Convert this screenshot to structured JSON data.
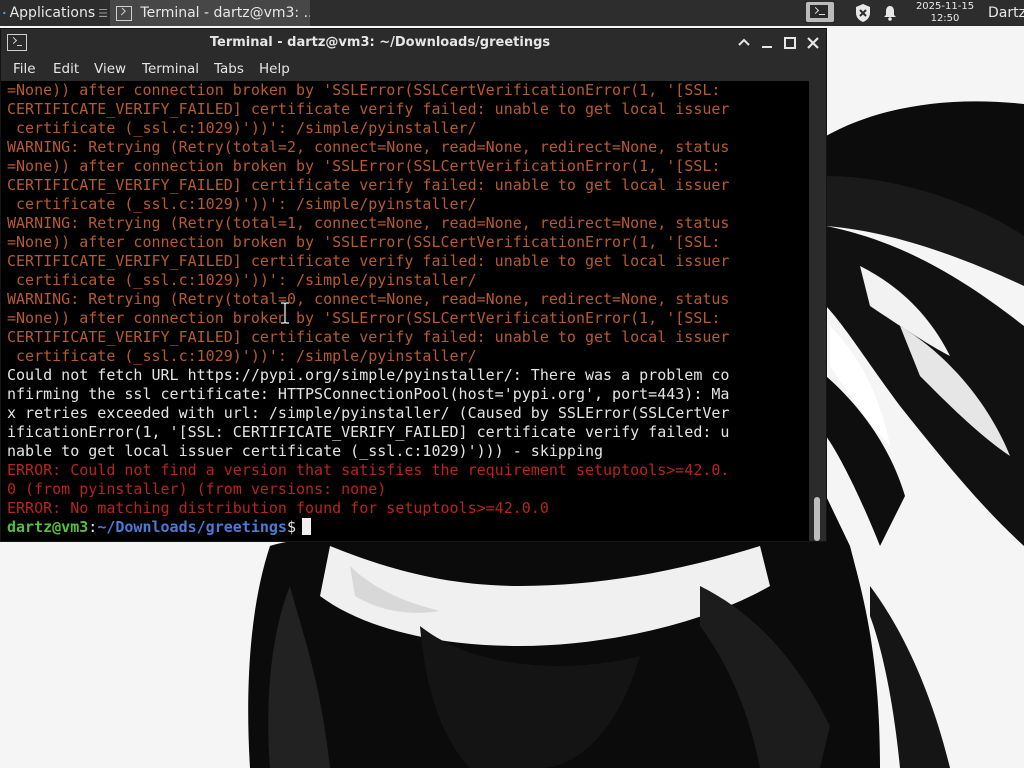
{
  "panel": {
    "apps_label": "Applications",
    "apps_sep": "☰",
    "task_label": "Terminal - dartz@vm3: ...",
    "clock_date": "2025-11-15",
    "clock_time": "12:50",
    "user": "Dartz"
  },
  "window": {
    "title": "Terminal - dartz@vm3: ~/Downloads/greetings",
    "menu": [
      "File",
      "Edit",
      "View",
      "Terminal",
      "Tabs",
      "Help"
    ]
  },
  "terminal": {
    "lines": [
      {
        "t": "warn",
        "text": "=None)) after connection broken by 'SSLError(SSLCertVerificationError(1, '[SSL:"
      },
      {
        "t": "warn",
        "text": "CERTIFICATE_VERIFY_FAILED] certificate verify failed: unable to get local issuer"
      },
      {
        "t": "warn",
        "text": " certificate (_ssl.c:1029)'))': /simple/pyinstaller/"
      },
      {
        "t": "warn",
        "text": "WARNING: Retrying (Retry(total=2, connect=None, read=None, redirect=None, status"
      },
      {
        "t": "warn",
        "text": "=None)) after connection broken by 'SSLError(SSLCertVerificationError(1, '[SSL:"
      },
      {
        "t": "warn",
        "text": "CERTIFICATE_VERIFY_FAILED] certificate verify failed: unable to get local issuer"
      },
      {
        "t": "warn",
        "text": " certificate (_ssl.c:1029)'))': /simple/pyinstaller/"
      },
      {
        "t": "warn",
        "text": "WARNING: Retrying (Retry(total=1, connect=None, read=None, redirect=None, status"
      },
      {
        "t": "warn",
        "text": "=None)) after connection broken by 'SSLError(SSLCertVerificationError(1, '[SSL:"
      },
      {
        "t": "warn",
        "text": "CERTIFICATE_VERIFY_FAILED] certificate verify failed: unable to get local issuer"
      },
      {
        "t": "warn",
        "text": " certificate (_ssl.c:1029)'))': /simple/pyinstaller/"
      },
      {
        "t": "warn",
        "text": "WARNING: Retrying (Retry(total=0, connect=None, read=None, redirect=None, status"
      },
      {
        "t": "warn",
        "text": "=None)) after connection broken by 'SSLError(SSLCertVerificationError(1, '[SSL:"
      },
      {
        "t": "warn",
        "text": "CERTIFICATE_VERIFY_FAILED] certificate verify failed: unable to get local issuer"
      },
      {
        "t": "warn",
        "text": " certificate (_ssl.c:1029)'))': /simple/pyinstaller/"
      },
      {
        "t": "norm",
        "text": "Could not fetch URL https://pypi.org/simple/pyinstaller/: There was a problem co"
      },
      {
        "t": "norm",
        "text": "nfirming the ssl certificate: HTTPSConnectionPool(host='pypi.org', port=443): Ma"
      },
      {
        "t": "norm",
        "text": "x retries exceeded with url: /simple/pyinstaller/ (Caused by SSLError(SSLCertVer"
      },
      {
        "t": "norm",
        "text": "ificationError(1, '[SSL: CERTIFICATE_VERIFY_FAILED] certificate verify failed: u"
      },
      {
        "t": "norm",
        "text": "nable to get local issuer certificate (_ssl.c:1029)'))) - skipping"
      },
      {
        "t": "err",
        "text": "ERROR: Could not find a version that satisfies the requirement setuptools>=42.0."
      },
      {
        "t": "err",
        "text": "0 (from pyinstaller) (from versions: none)"
      },
      {
        "t": "err",
        "text": "ERROR: No matching distribution found for setuptools>=42.0.0"
      }
    ],
    "prompt": {
      "user_host": "dartz@vm3",
      "colon": ":",
      "path": "~/Downloads/greetings",
      "symbol": "$"
    }
  },
  "colors": {
    "warning": "#b75a2f",
    "error": "#b8241e",
    "prompt_user": "#58bf3c",
    "prompt_path": "#4b7bd6"
  },
  "icons": {
    "apps": "xfce-logo-icon",
    "tray_terminal": "terminal-icon",
    "tray_shield": "shield-icon",
    "tray_notifications": "bell-icon"
  }
}
